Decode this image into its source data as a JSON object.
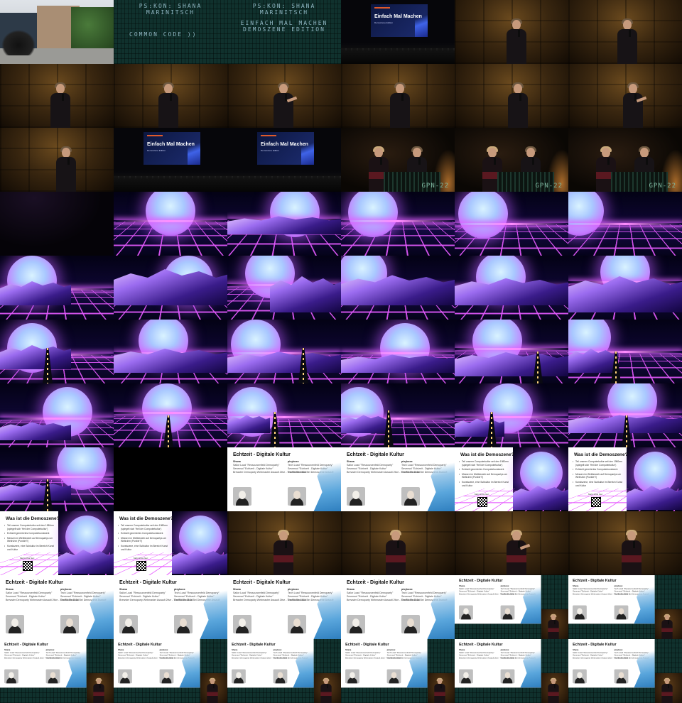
{
  "board_lines": {
    "name1": "PS:KON: SHANA",
    "name2": "MARINITSCH",
    "common": "COMMON CODE ))",
    "title1": "EINFACH MAL MACHEN",
    "title2": "DEMOSZENE EDITION"
  },
  "projection": {
    "title": "Einfach Mal Machen",
    "subtitle": "Demoszene Edition"
  },
  "gpn_label": "GPN-22",
  "slide_echtzeit": {
    "title": "Echtzeit - Digitale Kultur",
    "left_name": "Shana",
    "left_lines": [
      "Sailor Load \"Ressourcenfeld Demoparty\"",
      "Sevensol \"Echtzeit - Digitale Kultur\"",
      "Brewster Demoparty Webmaster Assault 2tive - The Bootle 313a"
    ],
    "right_name": "pixyboxx",
    "right_lines": [
      "Tech Load \"Ressourcenfeld Demoparty\"",
      "Sevensol \"Echtzeit - Digitale Kultur\"",
      "Graffiti Shokhlof Bei Demoszene Assault"
    ]
  },
  "slide_demoszene": {
    "title": "Was ist die Demoszene?",
    "bullets": [
      "Teil unserer Computerkultur seit den 1980ern (spiegelt sich 'Heil der Computerkultur')",
      "Echtzeit generiertes Computerkunstwerk",
      "Messen im Wettbewerb auf Demopartys um Weltruhm (Punkte?!)",
      "Kunstszene, eine Subkultur im Bereich Kunst und Kultur"
    ],
    "qr_caption": "Mehr Infos hier:"
  },
  "tiles": [
    "photo",
    "board_a",
    "board_b",
    "hall",
    "speaker_a",
    "speaker_b",
    "speaker_c",
    "speaker_d",
    "speaker_e",
    "speaker_f",
    "speaker_g",
    "speaker_h",
    "speaker_i",
    "hall",
    "hall",
    "duo",
    "duo",
    "duo",
    "dark",
    "syn1",
    "syn2",
    "syn3",
    "syn4",
    "syn5",
    "syn6",
    "syn7",
    "syn8",
    "syn9",
    "syn10",
    "syn11",
    "syn12",
    "syn13",
    "syn14",
    "syn15",
    "syn16",
    "syn17",
    "syn18",
    "syn19",
    "syn20",
    "syn21",
    "syn22",
    "syn23",
    "syn24",
    "empty",
    "echtzeit",
    "echtzeit",
    "demo",
    "demo",
    "demo",
    "demo",
    "speaker_j",
    "speaker_k",
    "speaker_l",
    "speaker_m",
    "echtzeit",
    "echtzeit",
    "echtzeit",
    "echtzeit",
    "comp",
    "comp",
    "comp",
    "comp",
    "comp",
    "comp",
    "comp",
    "comp"
  ]
}
